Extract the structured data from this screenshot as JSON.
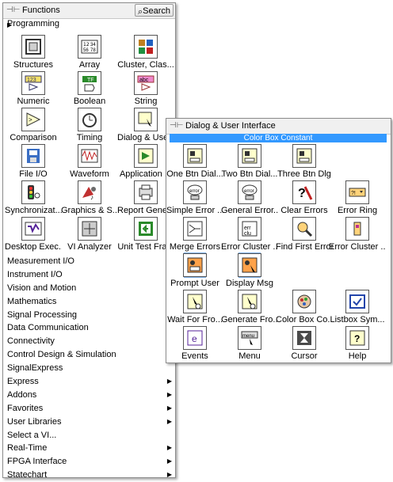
{
  "functions": {
    "title": "Functions",
    "search_label": "Search",
    "programming_label": "Programming",
    "grid": [
      {
        "label": "Structures",
        "icon": "structures-icon"
      },
      {
        "label": "Array",
        "icon": "array-icon"
      },
      {
        "label": "Cluster, Clas...",
        "icon": "cluster-icon"
      },
      {
        "label": "Numeric",
        "icon": "numeric-icon"
      },
      {
        "label": "Boolean",
        "icon": "boolean-icon"
      },
      {
        "label": "String",
        "icon": "string-icon"
      },
      {
        "label": "Comparison",
        "icon": "comparison-icon"
      },
      {
        "label": "Timing",
        "icon": "timing-icon"
      },
      {
        "label": "Dialog & Use...",
        "icon": "dialog-icon"
      },
      {
        "label": "File I/O",
        "icon": "file-io-icon"
      },
      {
        "label": "Waveform",
        "icon": "waveform-icon"
      },
      {
        "label": "Application ...",
        "icon": "application-icon"
      },
      {
        "label": "Synchronizat...",
        "icon": "synchronization-icon"
      },
      {
        "label": "Graphics & S...",
        "icon": "graphics-icon"
      },
      {
        "label": "Report Gener...",
        "icon": "report-icon"
      },
      {
        "label": "Desktop Exec...",
        "icon": "desktop-exec-icon"
      },
      {
        "label": "VI Analyzer",
        "icon": "vi-analyzer-icon"
      },
      {
        "label": "Unit Test Fra...",
        "icon": "unit-test-icon"
      }
    ],
    "categories": [
      {
        "label": "Measurement I/O",
        "arrow": false
      },
      {
        "label": "Instrument I/O",
        "arrow": false
      },
      {
        "label": "Vision and Motion",
        "arrow": false
      },
      {
        "label": "Mathematics",
        "arrow": false
      },
      {
        "label": "Signal Processing",
        "arrow": false
      },
      {
        "label": "Data Communication",
        "arrow": false
      },
      {
        "label": "Connectivity",
        "arrow": false
      },
      {
        "label": "Control Design & Simulation",
        "arrow": false
      },
      {
        "label": "SignalExpress",
        "arrow": false
      },
      {
        "label": "Express",
        "arrow": true
      },
      {
        "label": "Addons",
        "arrow": true
      },
      {
        "label": "Favorites",
        "arrow": true
      },
      {
        "label": "User Libraries",
        "arrow": true
      },
      {
        "label": "Select a VI...",
        "arrow": false
      },
      {
        "label": "Real-Time",
        "arrow": true
      },
      {
        "label": "FPGA Interface",
        "arrow": true
      },
      {
        "label": "Statechart",
        "arrow": true
      }
    ]
  },
  "dialog_palette": {
    "title": "Dialog & User Interface",
    "tooltip": "Color Box Constant",
    "grid": [
      {
        "label": "One Btn Dial...",
        "icon": "one-button-dialog-icon"
      },
      {
        "label": "Two Btn Dial...",
        "icon": "two-button-dialog-icon"
      },
      {
        "label": "Three Btn Dlg",
        "icon": "three-button-dialog-icon"
      },
      null,
      {
        "label": "Simple Error ...",
        "icon": "simple-error-icon"
      },
      {
        "label": "General Error...",
        "icon": "general-error-icon"
      },
      {
        "label": "Clear Errors",
        "icon": "clear-errors-icon"
      },
      {
        "label": "Error Ring",
        "icon": "error-ring-icon"
      },
      {
        "label": "Merge Errors",
        "icon": "merge-errors-icon"
      },
      {
        "label": "Error Cluster ...",
        "icon": "error-cluster-icon"
      },
      {
        "label": "Find First Error",
        "icon": "find-first-error-icon"
      },
      {
        "label": "Error Cluster ...",
        "icon": "error-cluster-constant-icon"
      },
      {
        "label": "Prompt User",
        "icon": "prompt-user-icon"
      },
      {
        "label": "Display Msg",
        "icon": "display-msg-icon"
      },
      null,
      null,
      {
        "label": "Wait For Fro...",
        "icon": "wait-for-front-panel-icon"
      },
      {
        "label": "Generate Fro...",
        "icon": "generate-front-panel-icon"
      },
      {
        "label": "Color Box Co...",
        "icon": "color-box-constant-icon"
      },
      {
        "label": "Listbox Sym...",
        "icon": "listbox-symbol-icon"
      },
      {
        "label": "Events",
        "icon": "events-icon"
      },
      {
        "label": "Menu",
        "icon": "menu-icon"
      },
      {
        "label": "Cursor",
        "icon": "cursor-icon"
      },
      {
        "label": "Help",
        "icon": "help-icon"
      }
    ]
  },
  "colors": {
    "tooltip_bg": "#3399ff",
    "selection_bg": "#d7e8fb"
  }
}
